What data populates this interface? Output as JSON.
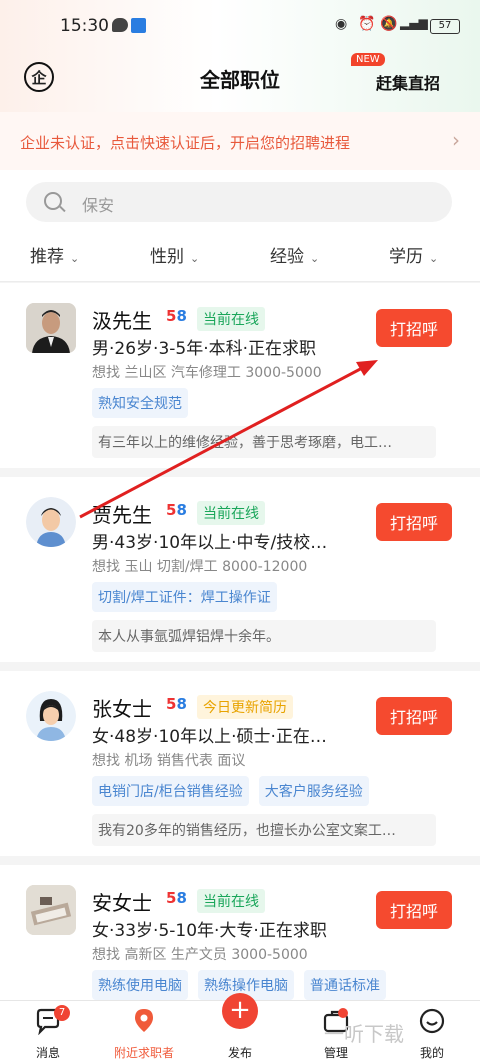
{
  "status_bar": {
    "time": "15:30",
    "icons": [
      "wechat-icon",
      "app-icon",
      "eye-icon",
      "alarm-icon",
      "mute-icon",
      "signal-icon"
    ],
    "battery": "57"
  },
  "header": {
    "title": "全部职位",
    "new_badge": "NEW",
    "right_link": "赶集直招",
    "logo_char": "企"
  },
  "banner": {
    "text": "企业未认证，点击快速认证后，开启您的招聘进程",
    "arrow": "›"
  },
  "search": {
    "placeholder": "保安"
  },
  "filters": [
    {
      "label": "推荐"
    },
    {
      "label": "性别"
    },
    {
      "label": "经验"
    },
    {
      "label": "学历"
    }
  ],
  "candidates": [
    {
      "name": "汲先生",
      "status": "当前在线",
      "status_type": "online",
      "info": "男·26岁·3-5年·本科·正在求职",
      "want": "想找 兰山区 汽车修理工 3000-5000",
      "tags": [
        "熟知安全规范"
      ],
      "desc": "有三年以上的维修经验，善于思考琢磨，电工…",
      "button": "打招呼"
    },
    {
      "name": "贾先生",
      "status": "当前在线",
      "status_type": "online",
      "info": "男·43岁·10年以上·中专/技校…",
      "want": "想找 玉山 切割/焊工 8000-12000",
      "tags": [
        "切割/焊工证件：焊工操作证"
      ],
      "desc": "本人从事氩弧焊铝焊十余年。",
      "button": "打招呼"
    },
    {
      "name": "张女士",
      "status": "今日更新简历",
      "status_type": "update",
      "info": "女·48岁·10年以上·硕士·正在…",
      "want": "想找 机场 销售代表 面议",
      "tags": [
        "电销门店/柜台销售经验",
        "大客户服务经验"
      ],
      "desc": "我有20多年的销售经历，也擅长办公室文案工…",
      "button": "打招呼"
    },
    {
      "name": "安女士",
      "status": "当前在线",
      "status_type": "online",
      "info": "女·33岁·5-10年·大专·正在求职",
      "want": "想找 高新区 生产文员 3000-5000",
      "tags": [
        "熟练使用电脑",
        "熟练操作电脑",
        "普通话标准"
      ],
      "desc": "",
      "button": "打招呼"
    }
  ],
  "badge_58": [
    "5",
    "8"
  ],
  "tabbar": {
    "items": [
      {
        "label": "消息",
        "icon": "message-icon",
        "badge": "7"
      },
      {
        "label": "附近求职者",
        "icon": "location-pin-icon",
        "active": true
      },
      {
        "label": "发布",
        "icon": "plus-icon",
        "symbol": "+"
      },
      {
        "label": "管理",
        "icon": "briefcase-icon"
      },
      {
        "label": "我的",
        "icon": "profile-icon"
      }
    ]
  },
  "watermark": "一听下载",
  "colors": {
    "accent": "#f54a2f",
    "online": "#1aa65a",
    "update": "#e8a300",
    "tag_blue": "#4a86d0"
  }
}
